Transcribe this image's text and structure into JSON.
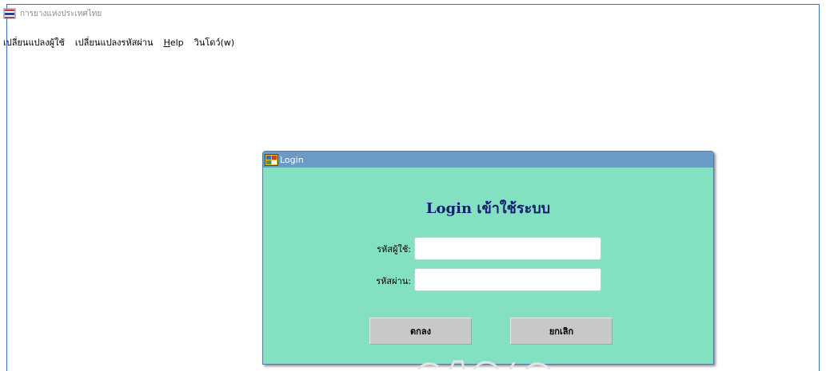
{
  "window": {
    "title": "การยางแห่งประเทศไทย",
    "icon": "thai-flag-app-icon"
  },
  "menubar": {
    "items": [
      {
        "label": "เปลี่ยนแปลงผู้ใช้"
      },
      {
        "label": "เปลี่ยนแปลงรหัสผ่าน"
      },
      {
        "label_underlined": "H",
        "label_rest": "elp"
      },
      {
        "label": "วินโดว์(w)"
      }
    ]
  },
  "login_dialog": {
    "title": "Login",
    "icon": "login-form-icon",
    "heading": "Login เข้าใช้ระบบ",
    "username": {
      "label": "รหัสผู้ใช้:",
      "value": "",
      "placeholder": ""
    },
    "password": {
      "label": "รหัสผ่าน:",
      "value": "",
      "placeholder": ""
    },
    "ok_label": "ตกลง",
    "cancel_label": "ยกเลิก"
  },
  "colors": {
    "dialog_bg": "#83e1c2",
    "dialog_titlebar": "#6b9ac7",
    "heading": "#0f1c72",
    "button": "#c8c8c8"
  }
}
